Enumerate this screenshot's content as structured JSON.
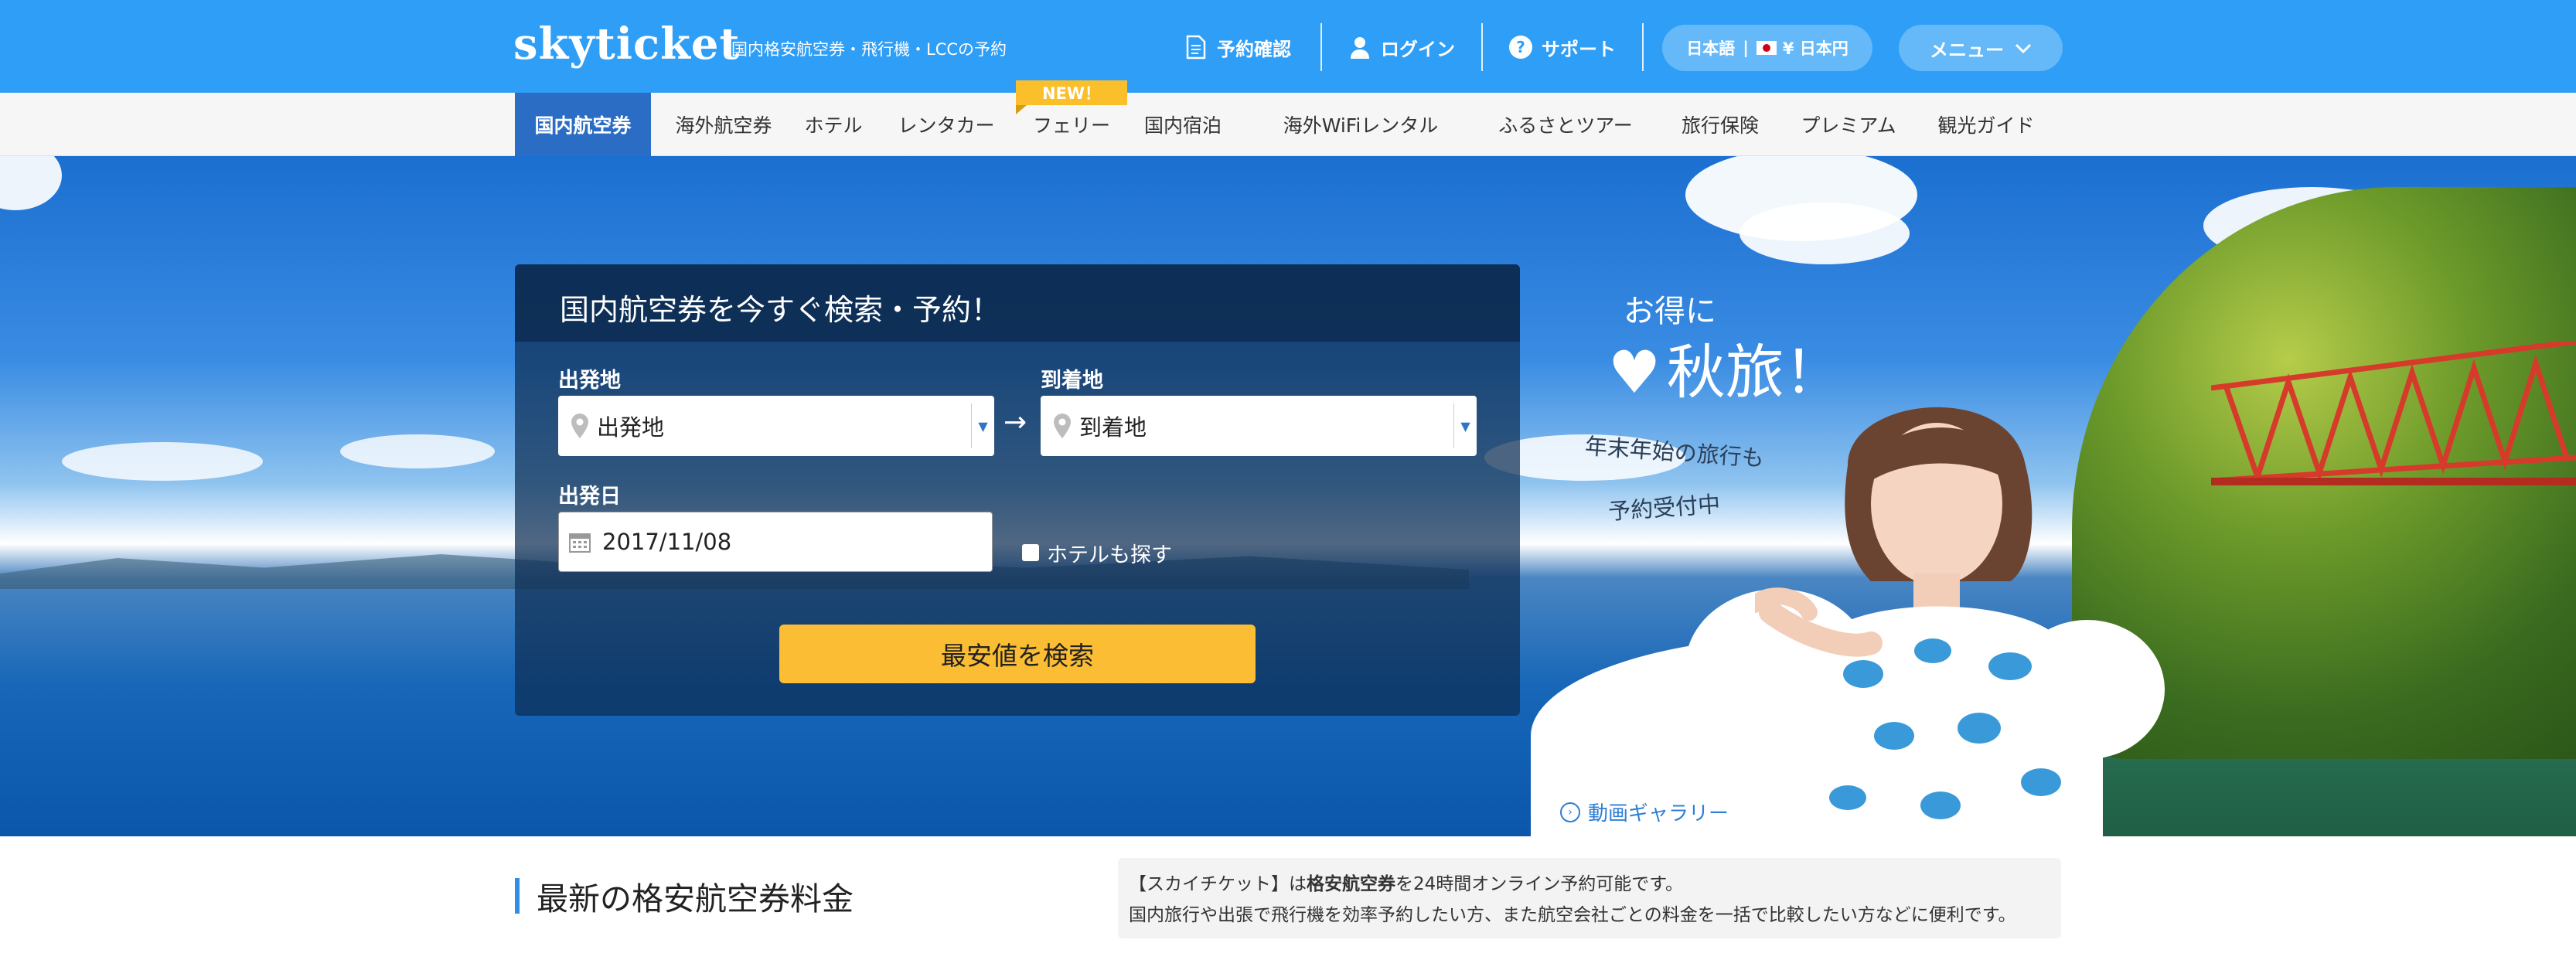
{
  "header": {
    "logo": "skyticket",
    "tagline": "国内格安航空券・飛行機・LCCの予約",
    "links": {
      "reservation": "予約確認",
      "login": "ログイン",
      "support": "サポート"
    },
    "language": "日本語",
    "currency": "¥ 日本円",
    "menu": "メニュー"
  },
  "nav": {
    "items": [
      "国内航空券",
      "海外航空券",
      "ホテル",
      "レンタカー",
      "フェリー",
      "国内宿泊",
      "海外WiFiレンタル",
      "ふるさとツアー",
      "旅行保険",
      "プレミアム",
      "観光ガイド"
    ],
    "new_badge": "NEW！"
  },
  "search": {
    "title": "国内航空券を今すぐ検索・予約！",
    "departure_label": "出発地",
    "departure_value": "出発地",
    "arrival_label": "到着地",
    "arrival_value": "到着地",
    "arrow": "→",
    "date_label": "出発日",
    "date_value": "2017/11/08",
    "hotel_check": "ホテルも探す",
    "submit": "最安値を検索"
  },
  "promo": {
    "line1": "お得に",
    "line2": "♥ 秋旅！",
    "line3": "年末年始の旅行も",
    "line4": "予約受付中",
    "gallery": "動画ギャラリー"
  },
  "section": {
    "title": "最新の格安航空券料金",
    "info_prefix": "【スカイチケット】は",
    "info_bold": "格安航空券",
    "info_suffix": "を24時間オンライン予約可能です。",
    "info_line2": "国内旅行や出張で飛行機を効率予約したい方、また航空会社ごとの料金を一括で比較したい方などに便利です。"
  },
  "colors": {
    "header": "#2f9ef6",
    "active_tab": "#2b6cc4",
    "search_button": "#fbbd33",
    "badge": "#fbbf2c"
  }
}
